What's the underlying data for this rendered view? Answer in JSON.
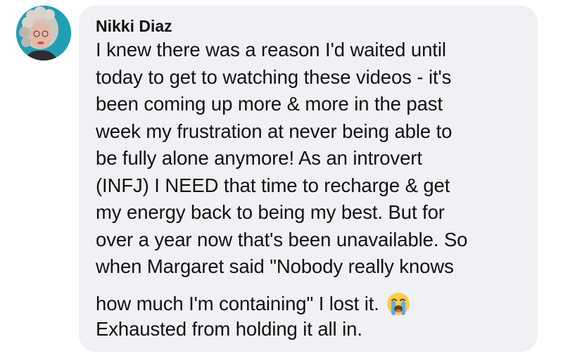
{
  "comment": {
    "author": "Nikki Diaz",
    "avatar_icon": "profile-photo",
    "lines": [
      "I knew there was a reason I'd waited until",
      "today to get to watching these videos - it's",
      "been coming up more & more in the past",
      "week my frustration at never being able to",
      "be fully alone anymore! As an introvert",
      "(INFJ) I NEED that time to recharge & get",
      "my energy back to being my best. But for",
      "over a year now that's been unavailable. So",
      "when Margaret said \"Nobody really knows",
      "how much I'm containing\" I lost it.",
      "Exhausted from holding it all in."
    ],
    "emoji": "😭",
    "emoji_icon": "loudly-crying-face-icon"
  },
  "colors": {
    "bubble_background": "#eff1f4",
    "text": "#111111",
    "avatar_background": "#1f9fb3"
  }
}
